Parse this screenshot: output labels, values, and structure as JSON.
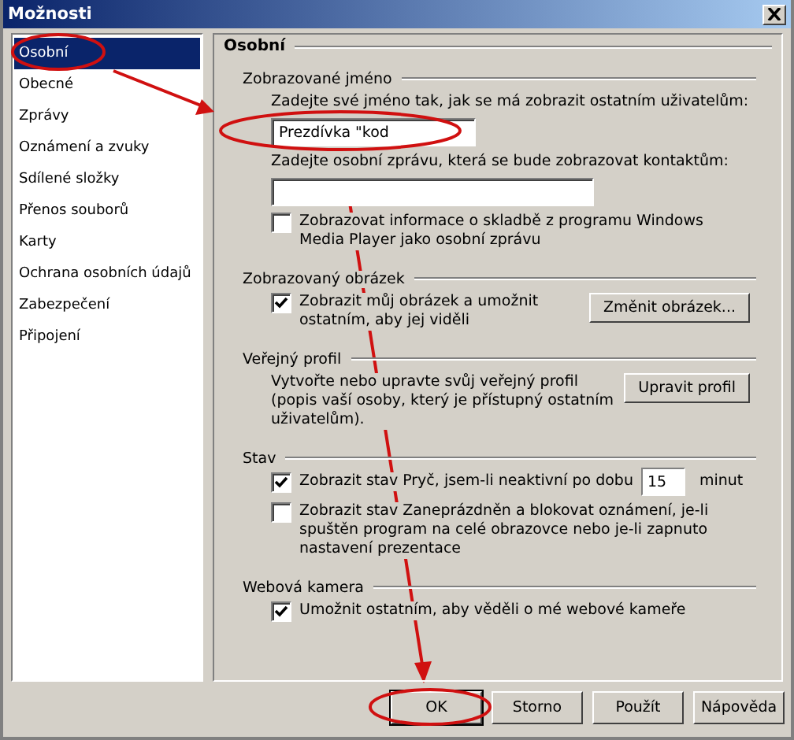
{
  "window": {
    "title": "Možnosti"
  },
  "sidebar": {
    "items": [
      {
        "label": "Osobní",
        "selected": true
      },
      {
        "label": "Obecné",
        "selected": false
      },
      {
        "label": "Zprávy",
        "selected": false
      },
      {
        "label": "Oznámení a zvuky",
        "selected": false
      },
      {
        "label": "Sdílené složky",
        "selected": false
      },
      {
        "label": "Přenos souborů",
        "selected": false
      },
      {
        "label": "Karty",
        "selected": false
      },
      {
        "label": "Ochrana osobních údajů",
        "selected": false
      },
      {
        "label": "Zabezpečení",
        "selected": false
      },
      {
        "label": "Připojení",
        "selected": false
      }
    ]
  },
  "panel": {
    "title": "Osobní",
    "sections": [
      {
        "title": "Zobrazované jméno",
        "items": [
          {
            "kind": "text",
            "text": "Zadejte své jméno tak, jak se má zobrazit ostatním uživatelům:"
          },
          {
            "kind": "field",
            "value": "Prezdívka \"kod"
          },
          {
            "kind": "text",
            "text": "Zadejte osobní zprávu, která se bude zobrazovat kontaktům:"
          },
          {
            "kind": "field"
          },
          {
            "kind": "checkbox",
            "checked": false,
            "label": "Zobrazovat informace o skladbě z programu Windows Media Player jako osobní zprávu"
          }
        ]
      },
      {
        "title": "Zobrazovaný obrázek",
        "items": [
          {
            "kind": "checkbox",
            "checked": true,
            "label": "Zobrazit můj obrázek a umožnit ostatním, aby jej viděli",
            "button": "Změnit obrázek..."
          }
        ]
      },
      {
        "title": "Veřejný profil",
        "items": [
          {
            "kind": "text",
            "text": "Vytvořte nebo upravte svůj veřejný profil (popis vaší osoby, který je přístupný ostatním uživatelům).",
            "button": "Upravit profil"
          }
        ]
      },
      {
        "title": "Stav",
        "items": [
          {
            "kind": "checkbox",
            "checked": true,
            "label": "Zobrazit stav Pryč, jsem-li neaktivní po dobu",
            "field_value": "15",
            "suffix": "minut"
          },
          {
            "kind": "checkbox",
            "checked": false,
            "label": "Zobrazit stav Zaneprázdněn a blokovat oznámení, je-li spuštěn program na celé obrazovce nebo je-li zapnuto nastavení prezentace"
          }
        ]
      },
      {
        "title": "Webová kamera",
        "items": [
          {
            "kind": "checkbox",
            "checked": true,
            "label": "Umožnit ostatním, aby věděli o mé webové kameře"
          }
        ]
      }
    ]
  },
  "buttons": [
    {
      "label": "OK",
      "default": true
    },
    {
      "label": "Storno",
      "default": false
    },
    {
      "label": "Použít",
      "default": false
    },
    {
      "label": "Nápověda",
      "default": false
    }
  ]
}
